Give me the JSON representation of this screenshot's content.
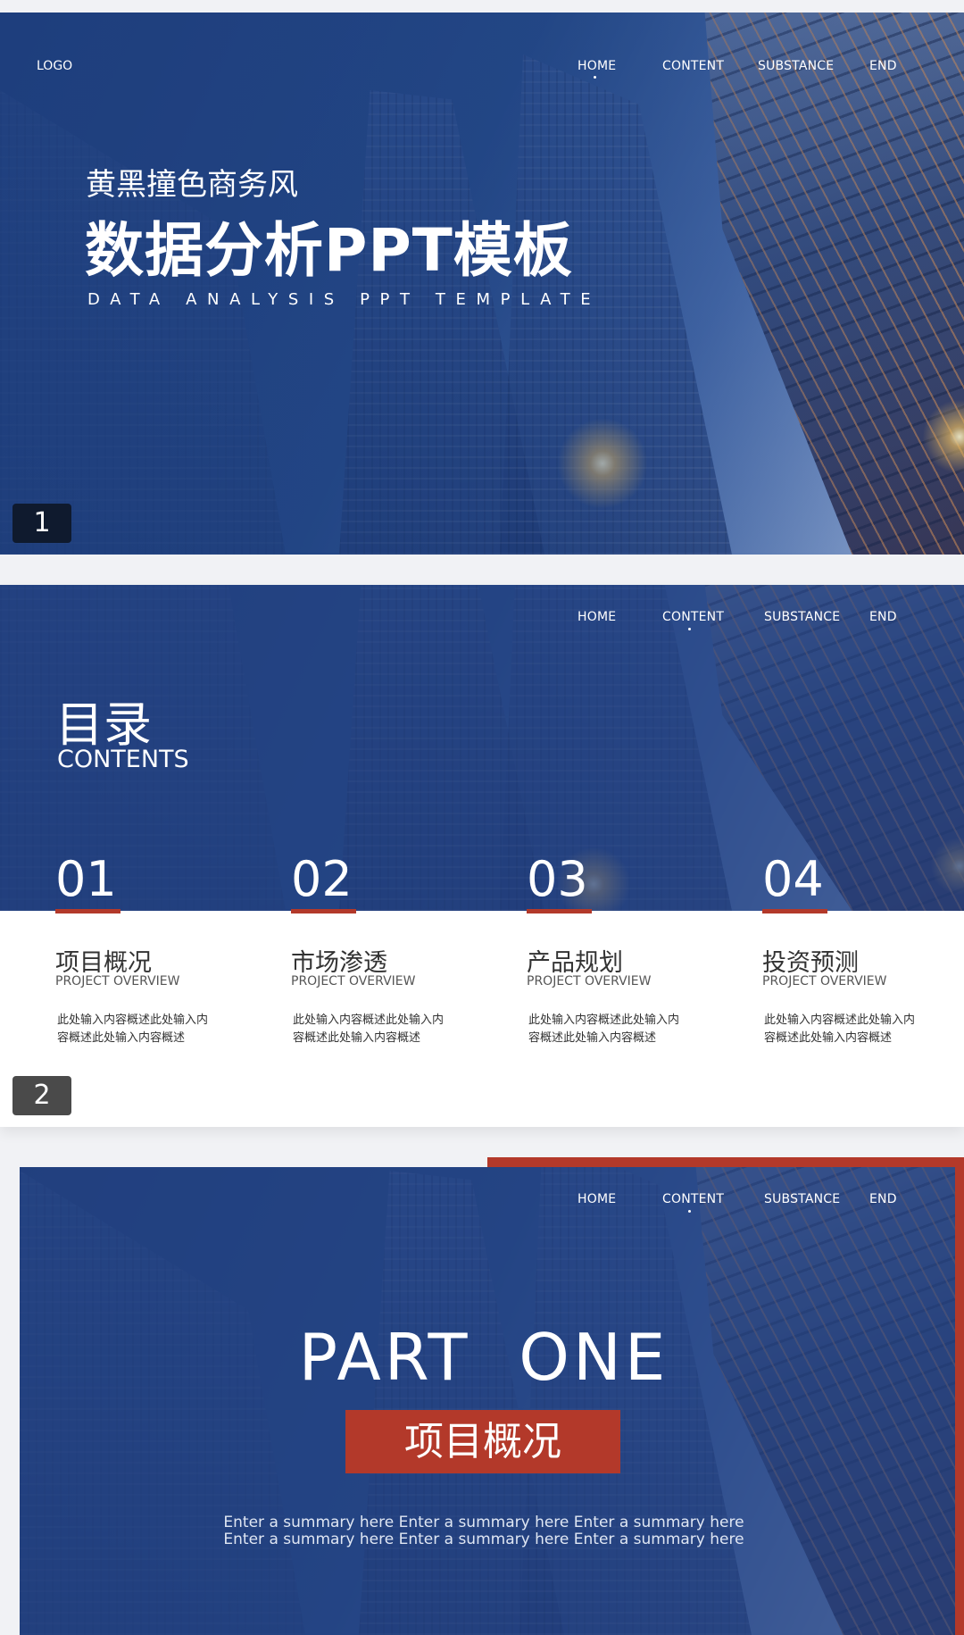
{
  "nav": {
    "items": [
      "HOME",
      "CONTENT",
      "SUBSTANCE",
      "END"
    ]
  },
  "slide1": {
    "logo": "LOGO",
    "subtitle": "黄黑撞色商务风",
    "title": "数据分析PPT模板",
    "en_title": "DATA ANALYSIS PPT TEMPLATE",
    "page_number": "1"
  },
  "slide2": {
    "title_cn": "目录",
    "title_en": "CONTENTS",
    "page_number": "2",
    "items": [
      {
        "num": "01",
        "title": "项目概况",
        "subtitle": "PROJECT OVERVIEW",
        "desc": "此处输入内容概述此处输入内容概述此处输入内容概述"
      },
      {
        "num": "02",
        "title": "市场渗透",
        "subtitle": "PROJECT OVERVIEW",
        "desc": "此处输入内容概述此处输入内容概述此处输入内容概述"
      },
      {
        "num": "03",
        "title": "产品规划",
        "subtitle": "PROJECT OVERVIEW",
        "desc": "此处输入内容概述此处输入内容概述此处输入内容概述"
      },
      {
        "num": "04",
        "title": "投资预测",
        "subtitle": "PROJECT OVERVIEW",
        "desc": "此处输入内容概述此处输入内容概述此处输入内容概述"
      }
    ]
  },
  "slide3": {
    "part": "PART  ONE",
    "part_title": "项目概况",
    "summary_line1": "Enter a summary here Enter a summary here Enter a summary here",
    "summary_line2": "Enter a summary here Enter a summary here Enter a summary here"
  },
  "colors": {
    "primary_blue": "#244a8c",
    "accent_red": "#b3392a",
    "page_badge_dark": "#0f1a2e",
    "page_badge_gray": "#4a4a4a"
  }
}
